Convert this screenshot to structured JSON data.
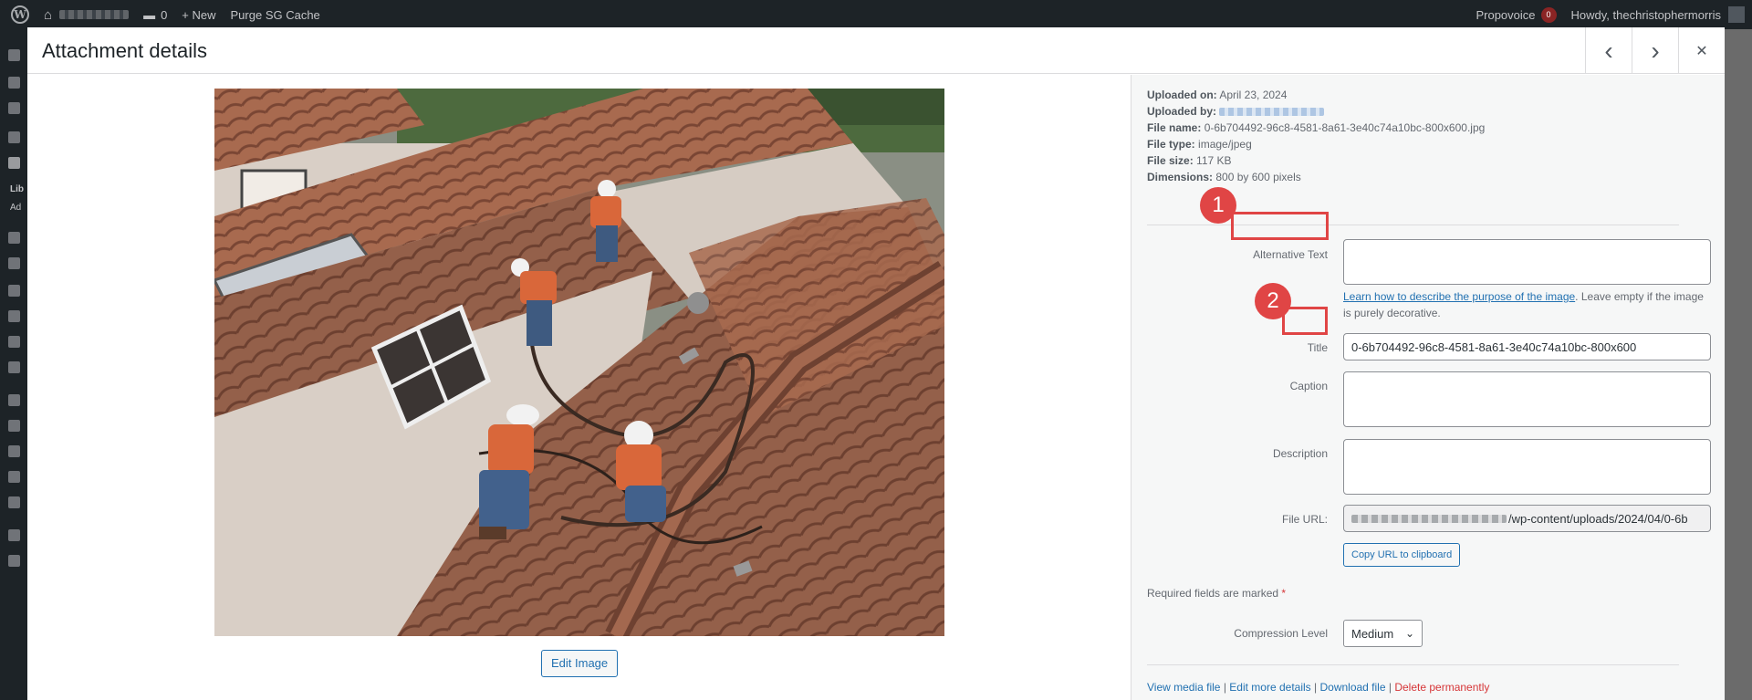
{
  "adminbar": {
    "comment_count": "0",
    "new_label": "+ New",
    "purge_label": "Purge SG Cache",
    "propovoice_label": "Propovoice",
    "propovoice_badge": "0",
    "howdy_label": "Howdy, thechristophermorris"
  },
  "sidemenu": {
    "label_lib": "Lib",
    "label_ad": "Ad"
  },
  "modal": {
    "title": "Attachment details",
    "prev_icon": "‹",
    "next_icon": "›",
    "close_icon": "✕"
  },
  "image_pane": {
    "edit_image_label": "Edit Image"
  },
  "meta": {
    "uploaded_on_label": "Uploaded on:",
    "uploaded_on": "April 23, 2024",
    "uploaded_by_label": "Uploaded by:",
    "file_name_label": "File name:",
    "file_name": "0-6b704492-96c8-4581-8a61-3e40c74a10bc-800x600.jpg",
    "file_type_label": "File type:",
    "file_type": "image/jpeg",
    "file_size_label": "File size:",
    "file_size": "117 KB",
    "dimensions_label": "Dimensions:",
    "dimensions": "800 by 600 pixels"
  },
  "form": {
    "alt_text_label": "Alternative Text",
    "alt_text_value": "",
    "help_link": "Learn how to describe the purpose of the image",
    "help_rest": ". Leave empty if the image is purely decorative.",
    "title_label": "Title",
    "title_value": "0-6b704492-96c8-4581-8a61-3e40c74a10bc-800x600",
    "caption_label": "Caption",
    "caption_value": "",
    "description_label": "Description",
    "description_value": "",
    "file_url_label": "File URL:",
    "file_url_value": "/wp-content/uploads/2024/04/0-6b",
    "copy_url_label": "Copy URL to clipboard",
    "required_note": "Required fields are marked",
    "required_star": "*",
    "compression_label": "Compression Level",
    "compression_value": "Medium"
  },
  "actions": {
    "view_media": "View media file",
    "edit_details": "Edit more details",
    "download": "Download file",
    "delete": "Delete permanently",
    "separator": "|"
  },
  "annotations": {
    "marker_1": "1",
    "marker_2": "2"
  },
  "colors": {
    "accent": "#2271b1",
    "danger": "#d63638",
    "annotation": "#e04545",
    "adminbar": "#1d2327"
  }
}
